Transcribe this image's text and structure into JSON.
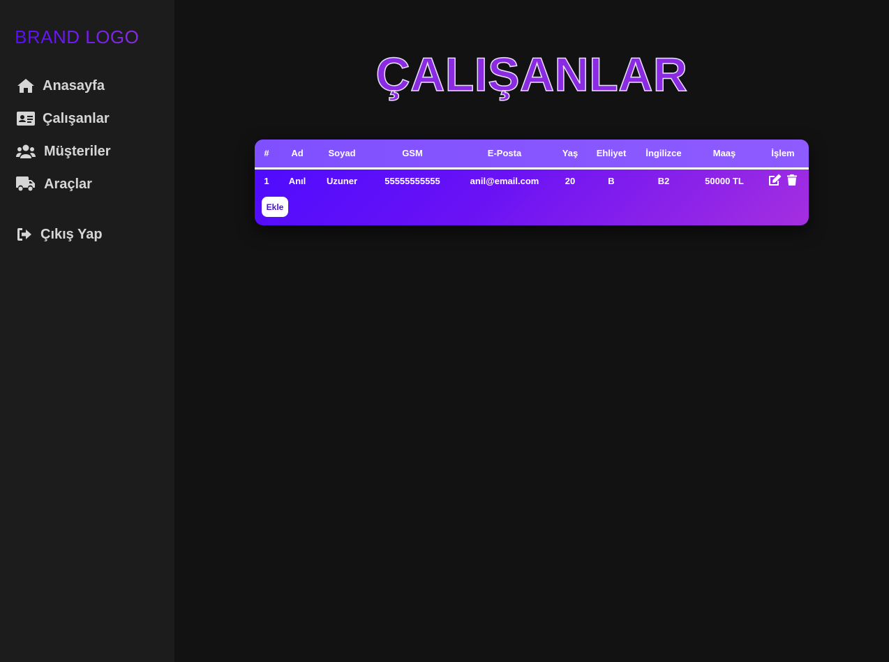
{
  "sidebar": {
    "brand": "BRAND LOGO",
    "items": [
      {
        "label": "Anasayfa",
        "icon": "home-icon"
      },
      {
        "label": "Çalışanlar",
        "icon": "id-card-icon"
      },
      {
        "label": "Müşteriler",
        "icon": "users-icon"
      },
      {
        "label": "Araçlar",
        "icon": "truck-icon"
      }
    ],
    "logout": {
      "label": "Çıkış Yap",
      "icon": "sign-out-icon"
    }
  },
  "main": {
    "title": "ÇALIŞANLAR",
    "table": {
      "columns": [
        "#",
        "Ad",
        "Soyad",
        "GSM",
        "E-Posta",
        "Yaş",
        "Ehliyet",
        "İngilizce",
        "Maaş",
        "İşlem"
      ],
      "rows": [
        {
          "no": "1",
          "ad": "Anıl",
          "soyad": "Uzuner",
          "gsm": "55555555555",
          "eposta": "anil@email.com",
          "yas": "20",
          "ehliyet": "B",
          "ingilizce": "B2",
          "maas": "50000 TL",
          "actions": [
            "edit-icon",
            "trash-icon"
          ]
        }
      ]
    },
    "add_button": "Ekle"
  },
  "colors": {
    "background": "#121212",
    "sidebar": "#1c1c1c",
    "accent": "#8a2be2",
    "brand": "#6a11ff",
    "nav_text": "#d6d6d6"
  }
}
